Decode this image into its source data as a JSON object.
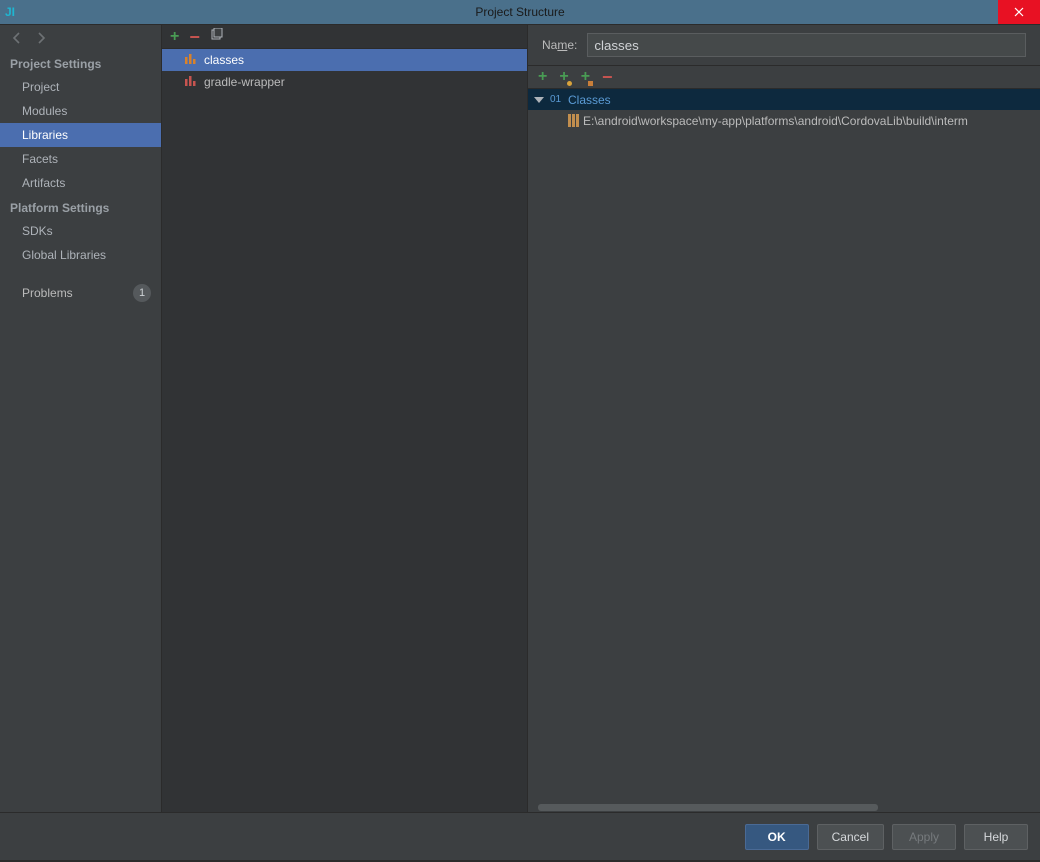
{
  "window": {
    "title": "Project Structure"
  },
  "sidebar": {
    "sections": [
      {
        "header": "Project Settings",
        "items": [
          "Project",
          "Modules",
          "Libraries",
          "Facets",
          "Artifacts"
        ],
        "selected": "Libraries"
      },
      {
        "header": "Platform Settings",
        "items": [
          "SDKs",
          "Global Libraries"
        ]
      }
    ],
    "problems": {
      "label": "Problems",
      "count": "1"
    }
  },
  "libraries": {
    "items": [
      {
        "name": "classes",
        "selected": true
      },
      {
        "name": "gradle-wrapper",
        "selected": false
      }
    ]
  },
  "details": {
    "name_label": "Name:",
    "name_value": "classes",
    "tree": {
      "root": "Classes",
      "children": [
        "E:\\android\\workspace\\my-app\\platforms\\android\\CordovaLib\\build\\interm"
      ]
    }
  },
  "buttons": {
    "ok": "OK",
    "cancel": "Cancel",
    "apply": "Apply",
    "help": "Help"
  }
}
